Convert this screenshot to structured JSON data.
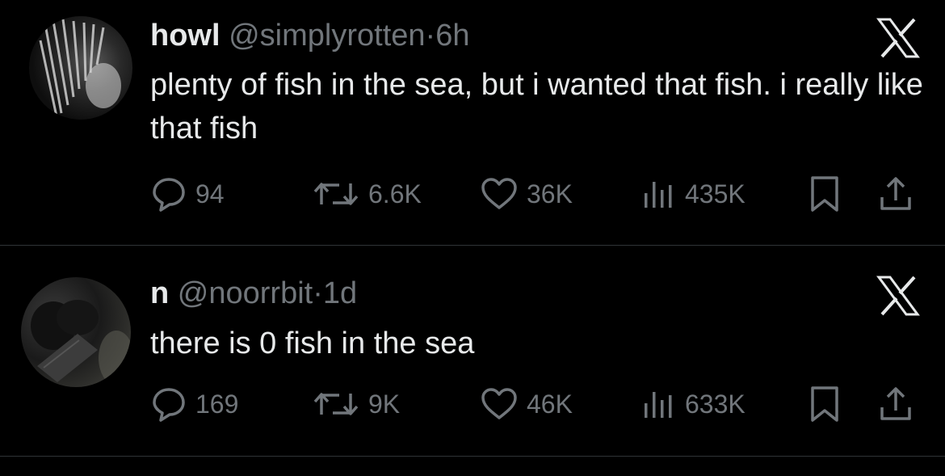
{
  "tweets": [
    {
      "name": "howl",
      "handle": "@simplyrotten",
      "dot": "·",
      "time": "6h",
      "text": "plenty of fish in the sea, but i wanted that fish. i really like that fish",
      "replies": "94",
      "reposts": "6.6K",
      "likes": "36K",
      "views": "435K"
    },
    {
      "name": "n",
      "handle": "@noorrbit",
      "dot": "·",
      "time": "1d",
      "text": "there is 0 fish in the sea",
      "replies": "169",
      "reposts": "9K",
      "likes": "46K",
      "views": "633K"
    }
  ],
  "icons": {
    "reply": "reply-icon",
    "repost": "repost-icon",
    "like": "heart-icon",
    "views": "views-icon",
    "bookmark": "bookmark-icon",
    "share": "share-icon",
    "close": "x-logo-icon"
  },
  "colors": {
    "background": "#000000",
    "text": "#e7e9ea",
    "secondary": "#71767b",
    "divider": "#2f3336"
  }
}
